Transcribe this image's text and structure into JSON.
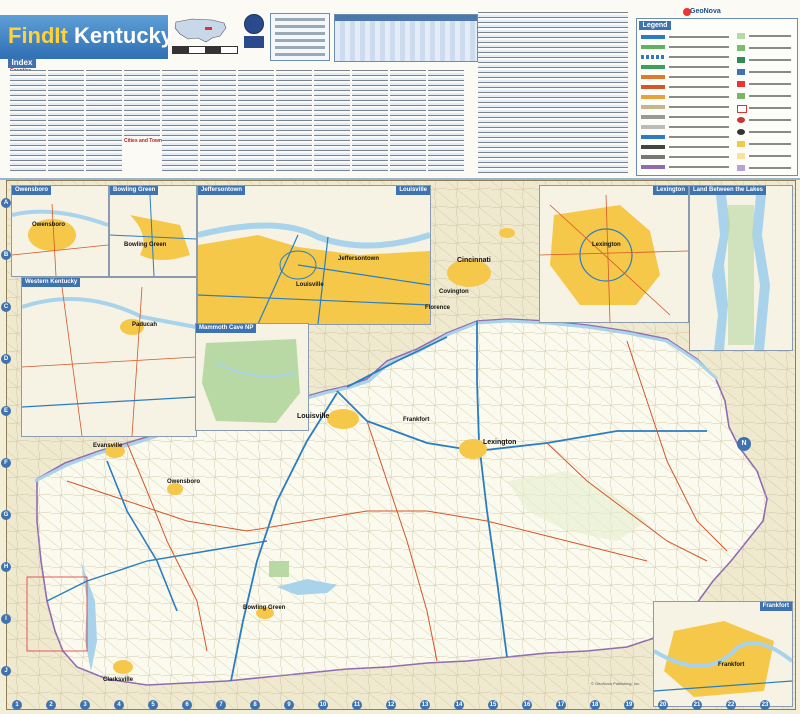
{
  "header": {
    "title_brand": "FindIt",
    "title_state": "Kentucky"
  },
  "index": {
    "label": "Index",
    "counties_heading": "Counties",
    "cities_heading": "Cities and Towns"
  },
  "legend": {
    "title": "Legend"
  },
  "publisher": {
    "name": "GeoNova",
    "copyright": "© GeoNova Publishing, Inc."
  },
  "insets": {
    "owensboro": "Owensboro",
    "bowling_green": "Bowling Green",
    "jeffersontown": "Jeffersontown",
    "louisville": "Louisville",
    "lexington": "Lexington",
    "land_between_the_lakes": "Land Between the Lakes",
    "western_kentucky": "Western Kentucky",
    "mammoth_cave": "Mammoth Cave NP",
    "frankfort": "Frankfort"
  },
  "inset_cities": {
    "owensboro": "Owensboro",
    "bowling_green": "Bowling Green",
    "louisville": "Louisville",
    "jeffersontown": "Jeffersontown",
    "lexington": "Lexington",
    "paducah": "Paducah",
    "frankfort": "Frankfort"
  },
  "cities": {
    "cincinnati": "Cincinnati",
    "louisville": "Louisville",
    "lexington": "Lexington",
    "evansville": "Evansville",
    "owensboro": "Owensboro",
    "bowling_green": "Bowling Green",
    "clarksville": "Clarksville",
    "frankfort": "Frankfort",
    "covington": "Covington",
    "florence": "Florence"
  },
  "compass": "N",
  "grid_letters": [
    "A",
    "B",
    "C",
    "D",
    "E",
    "F",
    "G",
    "H",
    "I",
    "J"
  ],
  "grid_numbers": [
    "1",
    "2",
    "3",
    "4",
    "5",
    "6",
    "7",
    "8",
    "9",
    "10",
    "11",
    "12",
    "13",
    "14",
    "15",
    "16",
    "17",
    "18",
    "19",
    "20",
    "21",
    "22",
    "23"
  ],
  "colors": {
    "water": "#a8d3ea",
    "urban": "#f6c84a",
    "park": "#b9d9a4",
    "interstate": "#2a7dc2",
    "highway": "#d4572a",
    "border": "#8f6bb0",
    "header_blue": "#3f73b0"
  }
}
